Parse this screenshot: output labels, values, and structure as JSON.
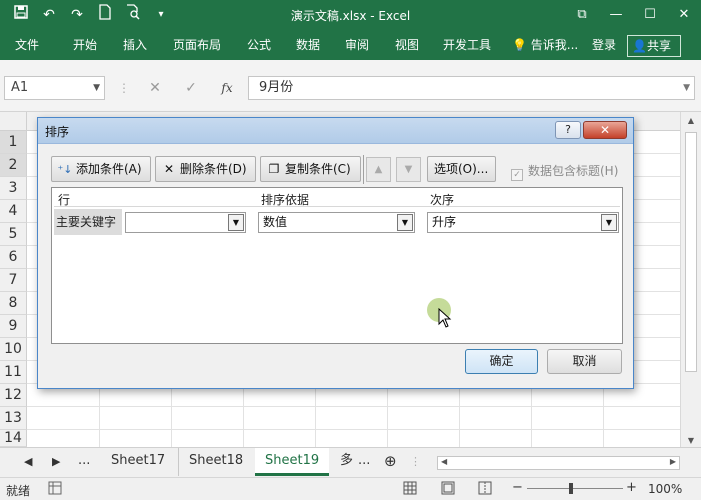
{
  "titlebar": {
    "doc_title": "演示文稿.xlsx - Excel",
    "qat": [
      {
        "name": "save-icon",
        "glyph": "💾"
      },
      {
        "name": "undo-icon",
        "glyph": "↶"
      },
      {
        "name": "redo-icon",
        "glyph": "↷"
      },
      {
        "name": "new-file-icon",
        "glyph": "🗋"
      },
      {
        "name": "print-preview-icon",
        "glyph": "🔍"
      },
      {
        "name": "customize-qat-icon",
        "glyph": "▾"
      }
    ],
    "window_controls": {
      "ribbon": "⧉",
      "minimize": "—",
      "maximize": "☐",
      "close": "✕"
    },
    "bg_color": "#217346"
  },
  "ribbon": {
    "tabs": [
      "文件",
      "开始",
      "插入",
      "页面布局",
      "公式",
      "数据",
      "审阅",
      "视图",
      "开发工具"
    ],
    "tell_me": "告诉我...",
    "login": "登录",
    "share": "共享"
  },
  "formula_bar": {
    "name_box": "A1",
    "cancel": "✕",
    "enter": "✓",
    "fx": "fx",
    "value": "9月份"
  },
  "grid": {
    "rows": [
      "1",
      "2",
      "3",
      "4",
      "5",
      "6",
      "7",
      "8",
      "9",
      "10",
      "11",
      "12",
      "13",
      "14"
    ]
  },
  "sheet_tabs": {
    "nav_ellipsis": "...",
    "tabs": [
      "Sheet17",
      "Sheet18",
      "Sheet19",
      "多"
    ],
    "active": "Sheet19",
    "add": "⊕"
  },
  "statusbar": {
    "ready": "就绪",
    "zoom": "100%",
    "zoom_minus": "−",
    "zoom_plus": "+"
  },
  "dialog": {
    "title": "排序",
    "help": "?",
    "close": "✕",
    "add_level": "添加条件(A)",
    "delete_level": "删除条件(D)",
    "copy_level": "复制条件(C)",
    "move_up": "▲",
    "move_down": "▼",
    "options": "选项(O)...",
    "has_headers": "数据包含标题(H)",
    "list_headers": {
      "column": "行",
      "sort_on": "排序依据",
      "order": "次序"
    },
    "level": {
      "label": "主要关键字",
      "key": "",
      "sort_on": "数值",
      "order": "升序"
    },
    "ok": "确定",
    "cancel": "取消"
  }
}
